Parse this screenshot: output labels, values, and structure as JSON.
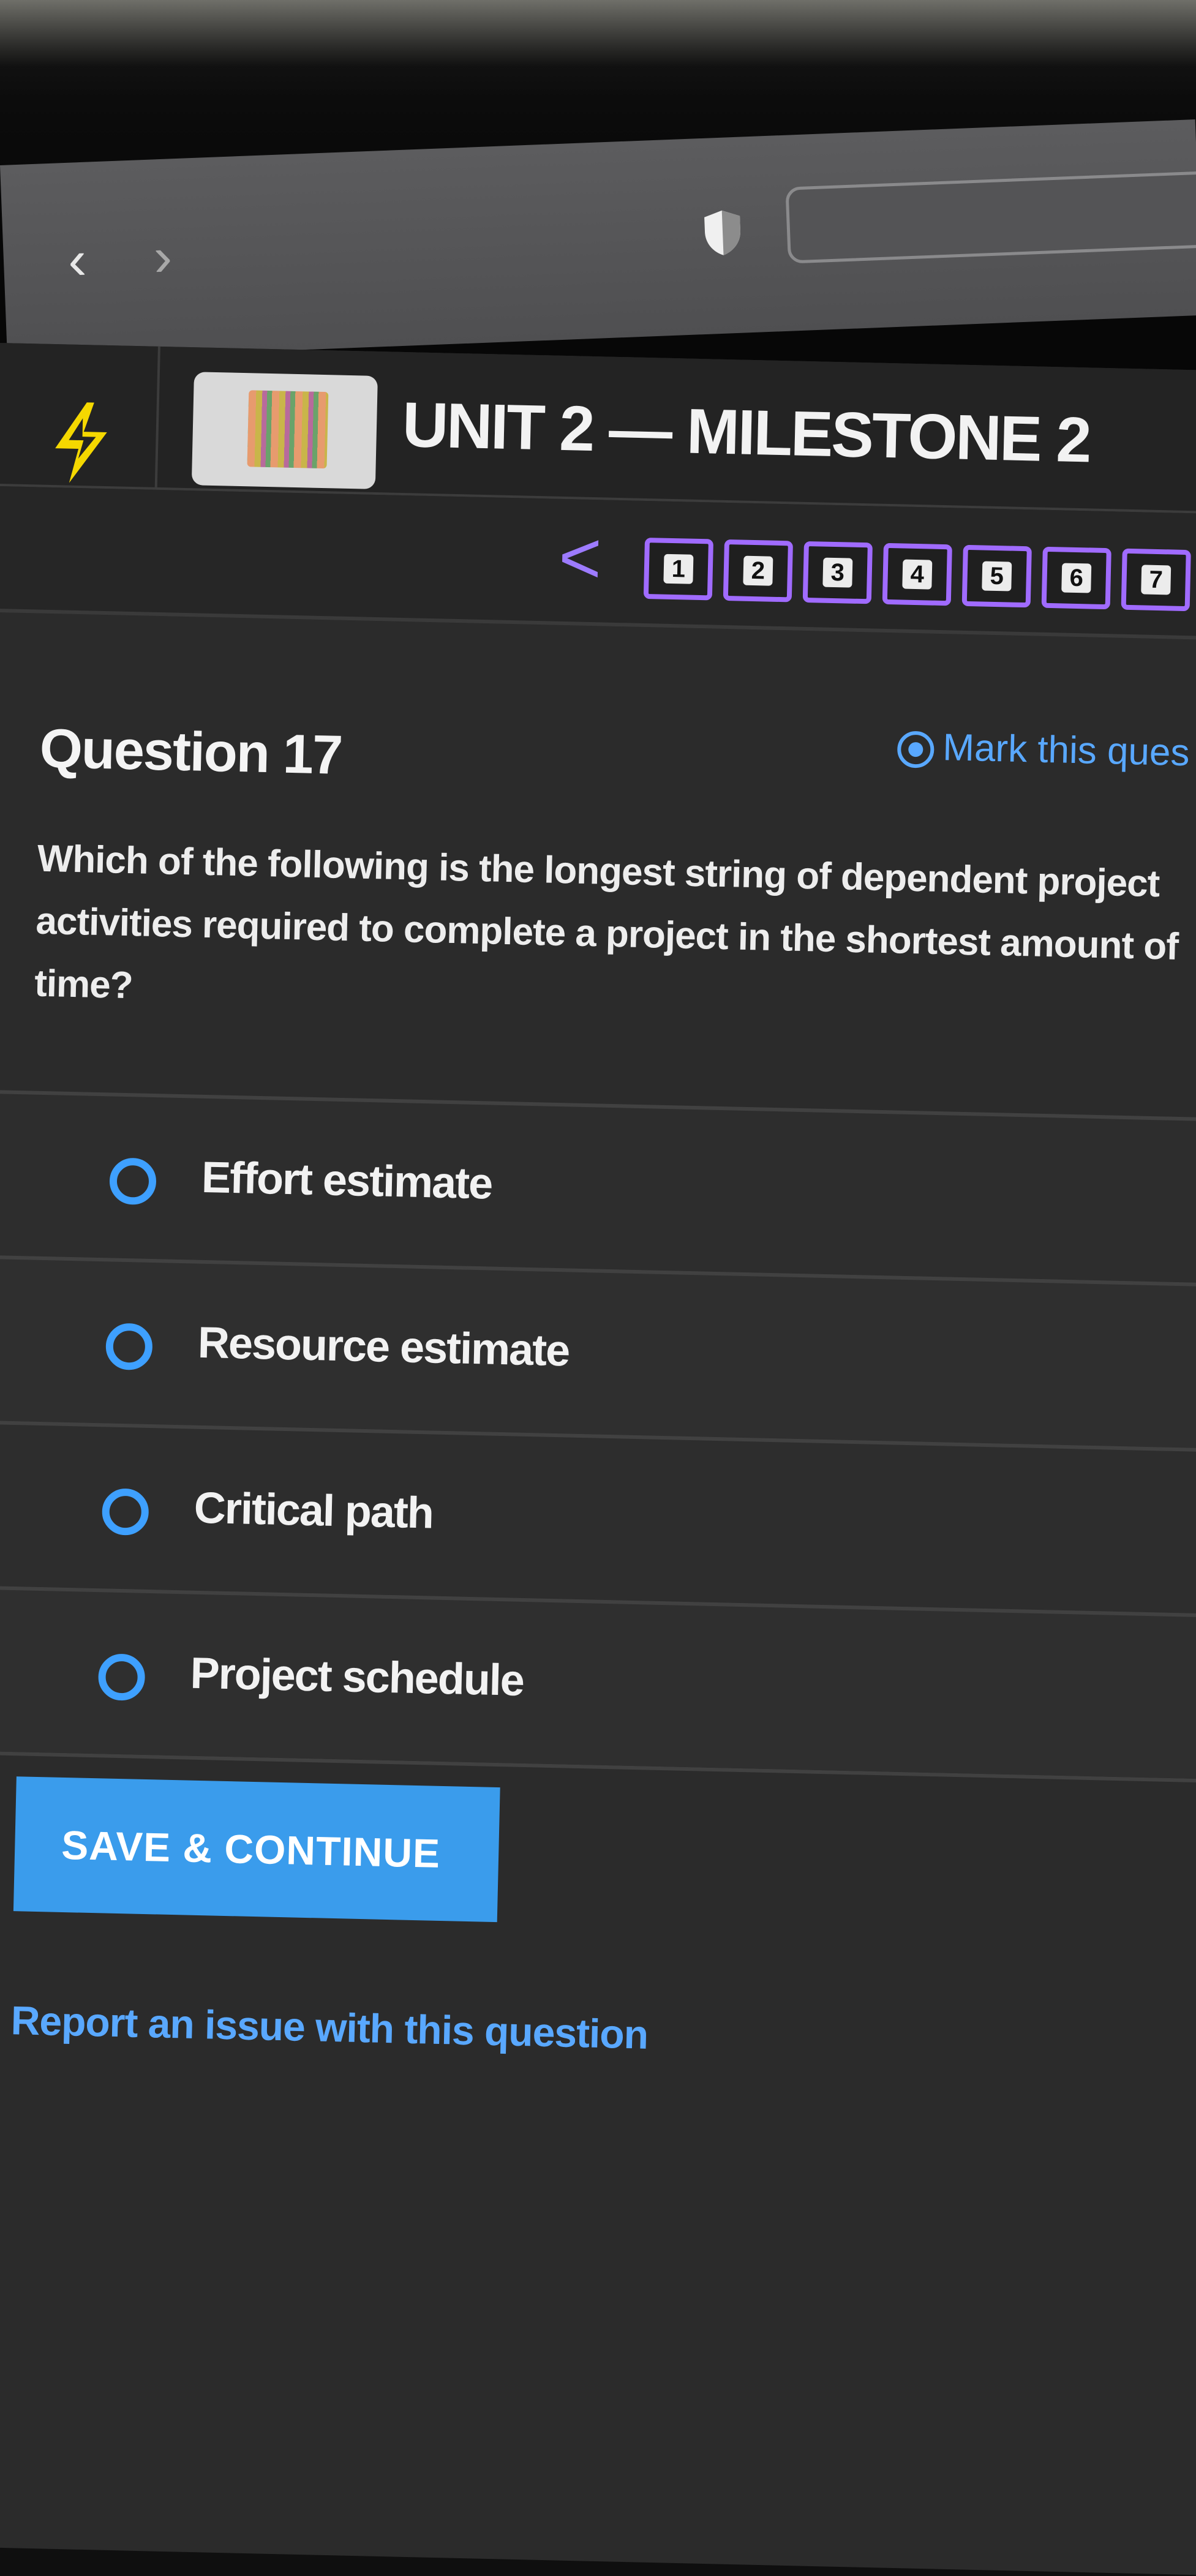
{
  "browser": {
    "back_icon": "chevron-left-icon",
    "forward_icon": "chevron-right-icon",
    "shield_icon": "shield-icon",
    "back_glyph": "‹",
    "forward_glyph": "›"
  },
  "header": {
    "title": "UNIT 2 — MILESTONE 2",
    "logo_icon": "lightning-logo-icon",
    "accent_color": "#f5d800"
  },
  "question_nav": {
    "prev_glyph": "<",
    "items": [
      "1",
      "2",
      "3",
      "4",
      "5",
      "6",
      "7"
    ],
    "accent_color": "#a06bff"
  },
  "question": {
    "label": "Question 17",
    "mark_label": "Mark this ques",
    "text": "Which of the following is the longest string of dependent project activities required to complete a project in the shortest amount of time?"
  },
  "options": [
    {
      "label": "Effort estimate"
    },
    {
      "label": "Resource estimate"
    },
    {
      "label": "Critical path"
    },
    {
      "label": "Project schedule"
    }
  ],
  "actions": {
    "save_label": "SAVE & CONTINUE",
    "report_label": "Report an issue with this question",
    "primary_color": "#3a9cec",
    "link_color": "#59a8ff"
  }
}
